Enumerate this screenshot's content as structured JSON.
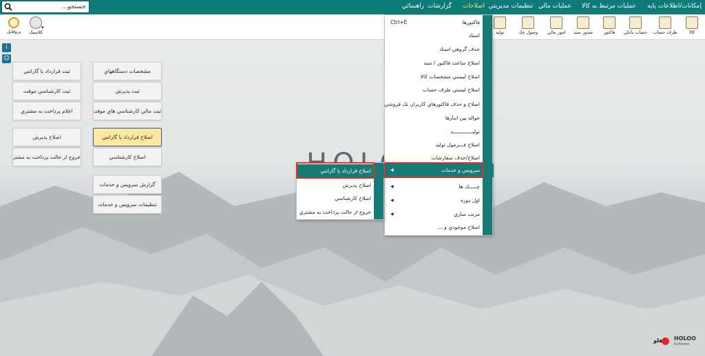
{
  "menubar": {
    "items": [
      "إمکانات/اطلاعات پايه",
      "عمليات مرتبط به کالا",
      "عمليات مالي",
      "تنظيمات مديريتي",
      "اصلاحات",
      "گزارشات",
      "راهنمائي"
    ],
    "active_index": 4
  },
  "search": {
    "placeholder": "جستجو..."
  },
  "toolbar": {
    "right": [
      {
        "label": "کالا",
        "icon": "box-icon"
      },
      {
        "label": "طرف حساب",
        "icon": "person-icon"
      },
      {
        "label": "حساب بانکي",
        "icon": "bank-icon"
      },
      {
        "label": "فاکتور",
        "icon": "invoice-icon"
      },
      {
        "label": "صدور سند",
        "icon": "document-icon"
      },
      {
        "label": "امور مالي",
        "icon": "calculator-icon"
      },
      {
        "label": "وصول چك",
        "icon": "cheque-icon"
      },
      {
        "label": "توليد",
        "icon": "production-icon"
      }
    ],
    "left": [
      {
        "label": "پروفايل",
        "icon": "profile-icon"
      },
      {
        "label": "كلاسيک",
        "icon": "classic-icon"
      }
    ]
  },
  "panel": {
    "col1": [
      "ثبت قرارداد يا گارانتي",
      "ثبت کارشناسي موقت",
      "اعلام پرداخت به مشتري",
      "اصلاح پذيرش",
      "خروج از حالت پرداخت به مشتري"
    ],
    "col2": [
      "مشخصات دستگاههاي",
      "ثبت پذيرش",
      "ثبت مالي کارشناسي هاي موقت",
      "اصلاح قرارداد يا گارانتي",
      "اصلاح کارشناسي",
      "گزارش سرويس و خدمات",
      "تنظيمات سرويس و خدمات"
    ]
  },
  "logo": {
    "text": "HOLO"
  },
  "main_menu": {
    "items": [
      {
        "label": "فاکتورها",
        "shortcut": "Ctrl+E"
      },
      {
        "label": "اسناد"
      },
      {
        "label": "حذف گروهي اسناد"
      },
      {
        "label": "اصلاح ساعت فاکتور / سند"
      },
      {
        "label": "اصلاح ليستي مشخصات کالا"
      },
      {
        "label": "اصلاح ليستي طرف حساب"
      },
      {
        "label": "اصلاح و حذف فاکتورهاي کاربران تك فروشي"
      },
      {
        "label": "حواله بين انبارها"
      },
      {
        "label": "توليـــــــــــــد"
      },
      {
        "label": "اصلاح فـــرمول توليد"
      },
      {
        "label": "اصلاح/حذف سفارشات"
      },
      {
        "label": "سرويس و خدمات",
        "submenu": true
      },
      {
        "label": "چـــــك ها",
        "submenu": true
      },
      {
        "label": "اول دوره",
        "submenu": true
      },
      {
        "label": "مرتب سازي",
        "submenu": true
      },
      {
        "label": "اصلاح موجودي و ..."
      }
    ],
    "highlight_index": 11
  },
  "sub_menu": {
    "items": [
      "اصلاح قرارداد يا گارانتي",
      "اصلاح پذيرش",
      "اصلاح كارشناسي",
      "خروج از حالت پرداخت به مشتري"
    ],
    "highlight_index": 0
  },
  "brand": {
    "name": "HOLOO",
    "tagline": "Software",
    "fa": "هلو"
  },
  "colors": {
    "teal": "#0e7b78",
    "active_menu": "#f3e36b",
    "highlight": "#187a76",
    "selection_border": "#d9342b"
  }
}
